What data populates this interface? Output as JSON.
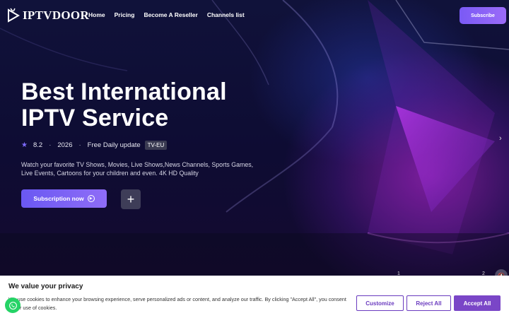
{
  "logo": {
    "prefix": "IPTV",
    "suffix": "DOOR"
  },
  "nav": {
    "items": [
      "Home",
      "Pricing",
      "Become A Reseller",
      "Channels list"
    ]
  },
  "header": {
    "subscribe_label": "Subscribe"
  },
  "hero": {
    "title_line1": "Best International",
    "title_line2": "IPTV Service",
    "rating": "8.2",
    "year": "2026",
    "update": "Free Daily update",
    "badge": "TV-EU",
    "description": "Watch your favorite TV Shows, Movies, Live Shows,News Channels, Sports Games, Live Events, Cartoons for your children and even. 4K HD Quality",
    "cta_label": "Subscription now",
    "plus_symbol": "+"
  },
  "slider": {
    "current": "1",
    "next": "2"
  },
  "cookie": {
    "title": "We value your privacy",
    "text": "We use cookies to enhance your browsing experience, serve personalized ads or content, and analyze our traffic. By clicking \"Accept All\", you consent to our use of cookies.",
    "customize_label": "Customize",
    "reject_label": "Reject All",
    "accept_label": "Accept All"
  },
  "icons": {
    "star": "star-icon",
    "play": "play-circle-icon",
    "whatsapp": "whatsapp-icon",
    "chevron": "chevron-right-icon",
    "mute": "mute-icon"
  },
  "colors": {
    "accent": "#7a5af5",
    "cookie_accent": "#7a46c7",
    "whatsapp": "#25d366"
  }
}
